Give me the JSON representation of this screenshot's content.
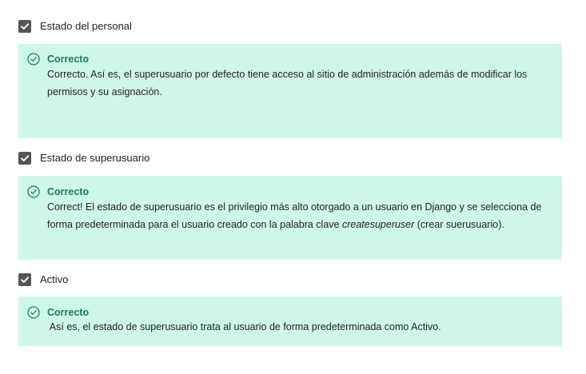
{
  "options": [
    {
      "label": "Estado del personal",
      "checked": true,
      "feedback": {
        "title": "Correcto",
        "text": "Correcto. Así es, el superusuario por defecto tiene acceso al sitio de administración además de modificar los permisos y su asignación."
      }
    },
    {
      "label": "Estado de superusuario",
      "checked": true,
      "feedback": {
        "title": "Correcto",
        "text_before": "Correct! El estado de superusuario es el privilegio más alto otorgado a un usuario en Django y se selecciona de forma predeterminada para el usuario creado con la palabra clave ",
        "text_italic": "createsuperuser",
        "text_after": " (crear suerusuario)."
      }
    },
    {
      "label": "Activo",
      "checked": true,
      "feedback": {
        "title": "Correcto",
        "text": " Así es, el estado de superusuario trata al usuario de forma predeterminada como Activo."
      }
    }
  ],
  "icons": {
    "checkbox": "checkmark-icon",
    "feedback": "check-circle-icon"
  },
  "colors": {
    "checkbox_bg": "#555555",
    "feedback_bg": "#cff7e9",
    "correct_text": "#1d7c50"
  }
}
